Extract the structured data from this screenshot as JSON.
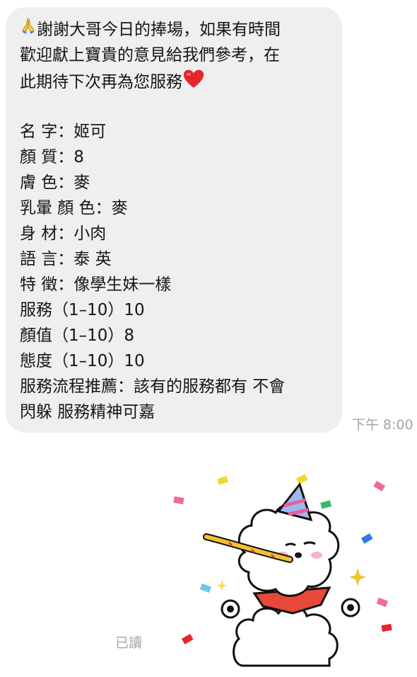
{
  "message": {
    "lines": [
      "謝謝大哥今日的捧場，如果有時間",
      "歡迎獻上寶貴的意見給我們參考，在",
      "此期待下次再為您服務",
      "",
      "名 字：姬可",
      "顏 質：8",
      "膚 色：麥",
      "乳暈 顏 色：麥",
      "身 材：小肉",
      "語 言：泰 英",
      "特 徵：像學生妹一樣",
      "服務（1–10）10",
      "顏值（1–10）8",
      "態度（1–10）10",
      "服務流程推薦：該有的服務都有 不會",
      "閃躲 服務精神可嘉"
    ],
    "leading_emoji": "folded-hands-icon",
    "trailing_emoji": "red-heart-icon",
    "timestamp": "下午 8:00"
  },
  "read_status": "已讀",
  "sticker": {
    "description_icon": "party-bear-sticker-icon"
  },
  "colors": {
    "bubble": "#efeff0",
    "meta_text": "#a4a4a8",
    "heart": "#e8242c"
  }
}
